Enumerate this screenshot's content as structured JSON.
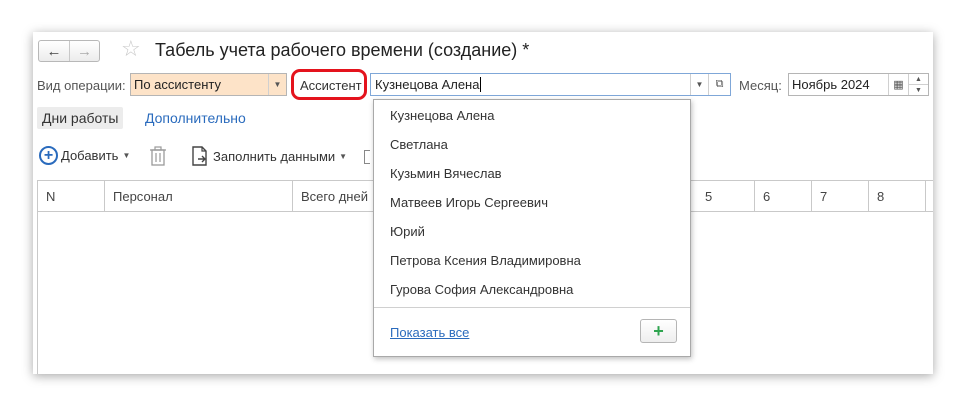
{
  "window": {
    "title": "Табель учета рабочего времени (создание) *",
    "nav_back": "←",
    "nav_forward": "→",
    "favorite_star": "☆"
  },
  "form": {
    "operation_label": "Вид операции:",
    "operation_value": "По ассистенту",
    "assistant_label": "Ассистент",
    "assistant_value": "Кузнецова Алена",
    "month_label": "Месяц:",
    "month_value": "Ноябрь 2024"
  },
  "tabs": [
    {
      "label": "Дни работы",
      "active": true
    },
    {
      "label": "Дополнительно",
      "active": false
    }
  ],
  "toolbar": {
    "add_label": "Добавить",
    "fill_label": "Заполнить данными"
  },
  "table": {
    "columns": [
      "N",
      "Персонал",
      "Всего дней",
      "5",
      "6",
      "7",
      "8"
    ]
  },
  "dropdown": {
    "items": [
      "Кузнецова Алена",
      "Светлана",
      "Кузьмин Вячеслав",
      "Матвеев Игорь Сергеевич",
      "Юрий",
      "Петрова Ксения Владимировна",
      "Гурова София Александровна"
    ],
    "show_all": "Показать все"
  },
  "colors": {
    "accent": "#2a6bbd",
    "highlight_ring": "#e4131d",
    "operation_field_bg": "#fde3c8",
    "add_green": "#2ea44f"
  }
}
